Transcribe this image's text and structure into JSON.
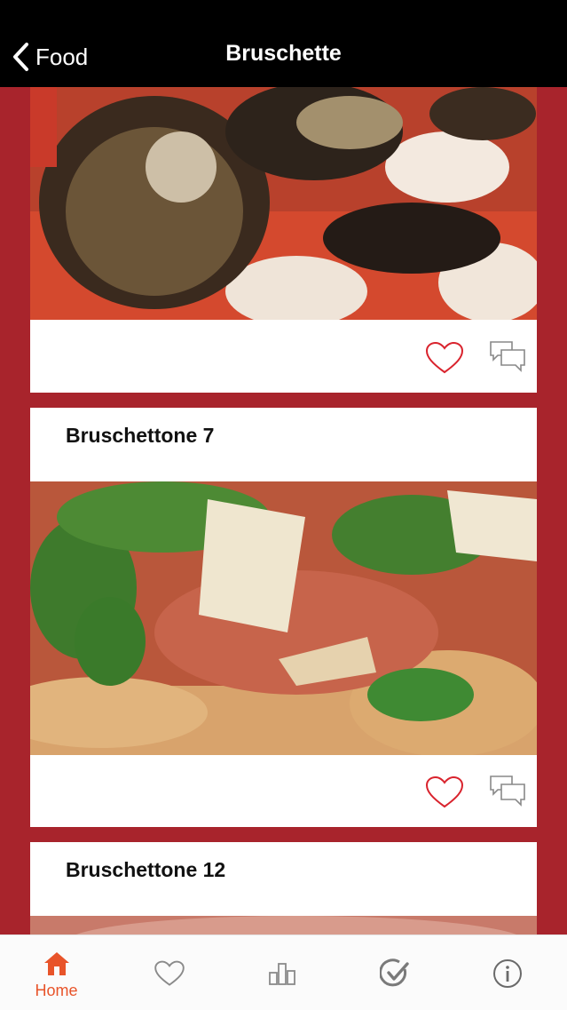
{
  "navbar": {
    "back_label": "Food",
    "title": "Bruschette"
  },
  "cards": [
    {
      "title": ""
    },
    {
      "title": "Bruschettone 7"
    },
    {
      "title": "Bruschettone 12"
    }
  ],
  "tabbar": {
    "items": [
      {
        "label": "Home",
        "icon": "home-icon",
        "active": true
      },
      {
        "label": "",
        "icon": "heart-icon"
      },
      {
        "label": "",
        "icon": "bar-chart-icon"
      },
      {
        "label": "",
        "icon": "check-circle-icon"
      },
      {
        "label": "",
        "icon": "info-icon"
      }
    ]
  },
  "colors": {
    "background": "#a8242c",
    "navbar": "#000000",
    "accent": "#e8542a",
    "heart": "#d9232d"
  }
}
